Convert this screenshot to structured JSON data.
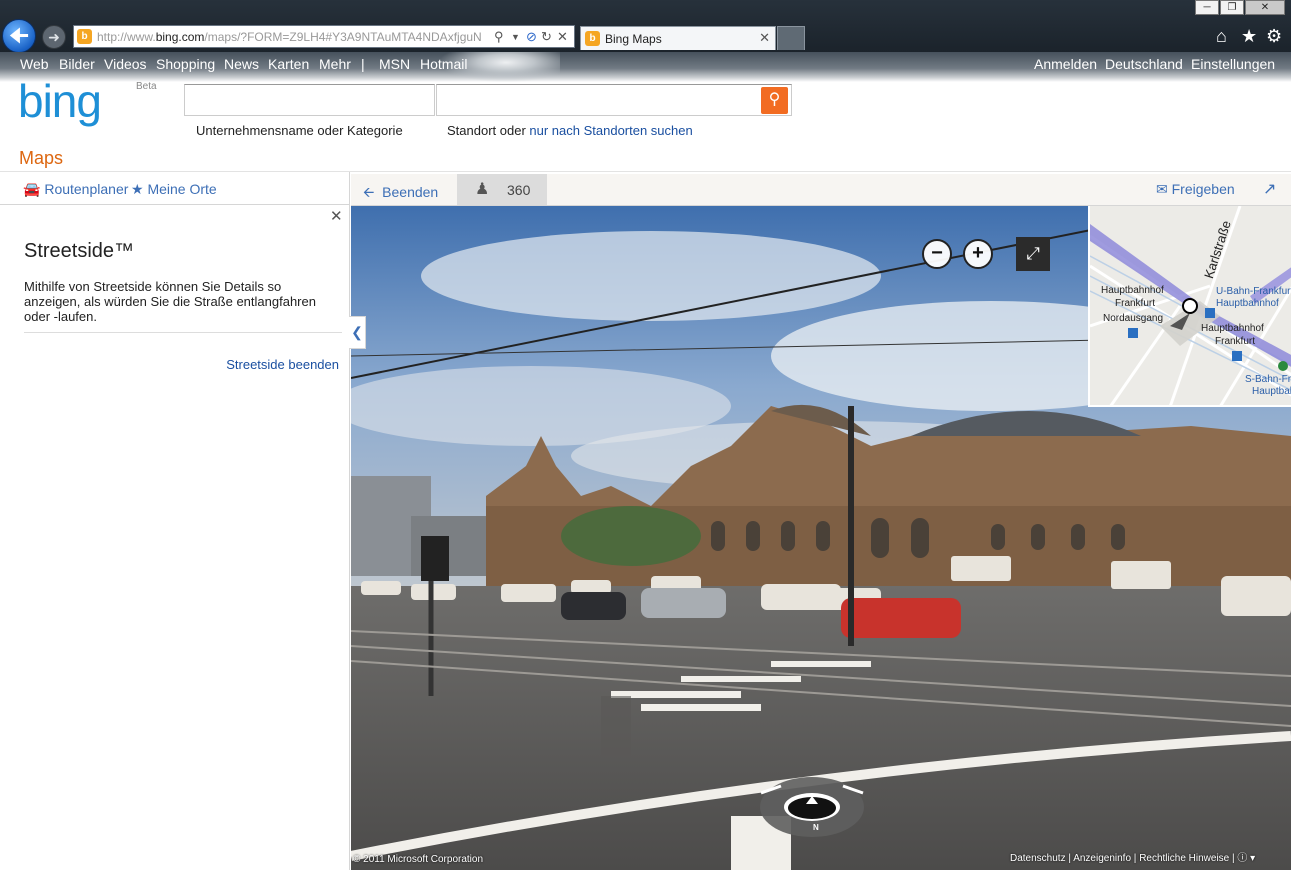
{
  "browser": {
    "url_prefix": "http://www.",
    "url_domain": "bing.com",
    "url_rest": "/maps/?FORM=Z9LH4#Y3A9NTAuMTA4NDAxfjguN",
    "tab_title": "Bing Maps",
    "favicon_letter": "b"
  },
  "nav": {
    "left": [
      "Web",
      "Bilder",
      "Videos",
      "Shopping",
      "News",
      "Karten",
      "Mehr",
      "|",
      "MSN",
      "Hotmail"
    ],
    "right": [
      "Anmelden",
      "Deutschland",
      "Einstellungen"
    ]
  },
  "logo": {
    "text": "bing",
    "beta": "Beta"
  },
  "search": {
    "label_business": "Unternehmensname oder Kategorie",
    "label_location": "Standort oder ",
    "label_location_link": "nur nach Standorten suchen",
    "business_value": "",
    "location_value": ""
  },
  "page_title": "Maps",
  "left_panel": {
    "route": "Routenplaner",
    "places": "Meine Orte",
    "heading": "Streetside™",
    "description": "Mithilfe von Streetside können Sie Details so anzeigen, als würden Sie die Straße entlangfahren oder -laufen.",
    "end_link": "Streetside beenden"
  },
  "toolbar": {
    "back": "Beenden",
    "mode_value": "360",
    "share": "Freigeben"
  },
  "minimap": {
    "street": "Karlstraße",
    "labels": [
      "Hauptbahnhof",
      "Frankfurt",
      "Nordausgang",
      "Hauptbahnhof",
      "Frankfurt"
    ],
    "ubahn": [
      "U-Bahn-Frankfurt",
      "Hauptbahnhof"
    ],
    "sbahn": [
      "S-Bahn-Fra",
      "Hauptbah"
    ]
  },
  "compass": {
    "n": "N"
  },
  "footer": {
    "copyright": "© 2011 Microsoft Corporation",
    "links": [
      "Datenschutz",
      "Anzeigeninfo",
      "Rechtliche Hinweise"
    ]
  }
}
